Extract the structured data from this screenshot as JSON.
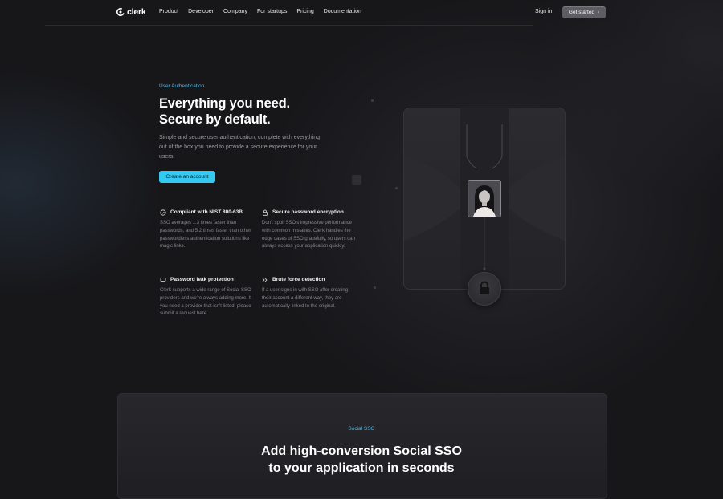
{
  "header": {
    "brand": "clerk",
    "nav": [
      "Product",
      "Developer",
      "Company",
      "For startups",
      "Pricing",
      "Documentation"
    ],
    "sign_in": "Sign in",
    "get_started": "Get started"
  },
  "hero": {
    "eyebrow": "User Authentication",
    "title_line1": "Everything you need.",
    "title_line2": "Secure by default.",
    "description": "Simple and secure user authentication, complete with everything out of the box you need to provide a secure experience for your users.",
    "cta": "Create an account"
  },
  "features": [
    {
      "icon": "shield-check-icon",
      "title": "Compliant with NIST 800-63B",
      "body": "SSO averages 1.3 times faster than passwords, and 5.2 times faster than other passwordless authentication solutions like magic links."
    },
    {
      "icon": "lock-icon",
      "title": "Secure password encryption",
      "body": "Don't spoil SSO's impressive performance with common mistakes. Clerk handles the edge cases of SSO gracefully, so users can always access your application quickly."
    },
    {
      "icon": "leak-shield-icon",
      "title": "Password leak protection",
      "body": "Clerk supports a wide range of Social SSO providers and we're always adding more. If you need a provider that isn't listed, please submit a request here."
    },
    {
      "icon": "chevrons-icon",
      "title": "Brute force detection",
      "body": "If a user signs in with SSO after creating their account a different way, they are automatically linked to the original."
    }
  ],
  "social": {
    "eyebrow": "Social SSO",
    "title_line1": "Add high-conversion Social SSO",
    "title_line2": "to your application in seconds"
  },
  "colors": {
    "accent": "#35c8f0",
    "eyebrow": "#4fb8e3",
    "background": "#17171a"
  }
}
